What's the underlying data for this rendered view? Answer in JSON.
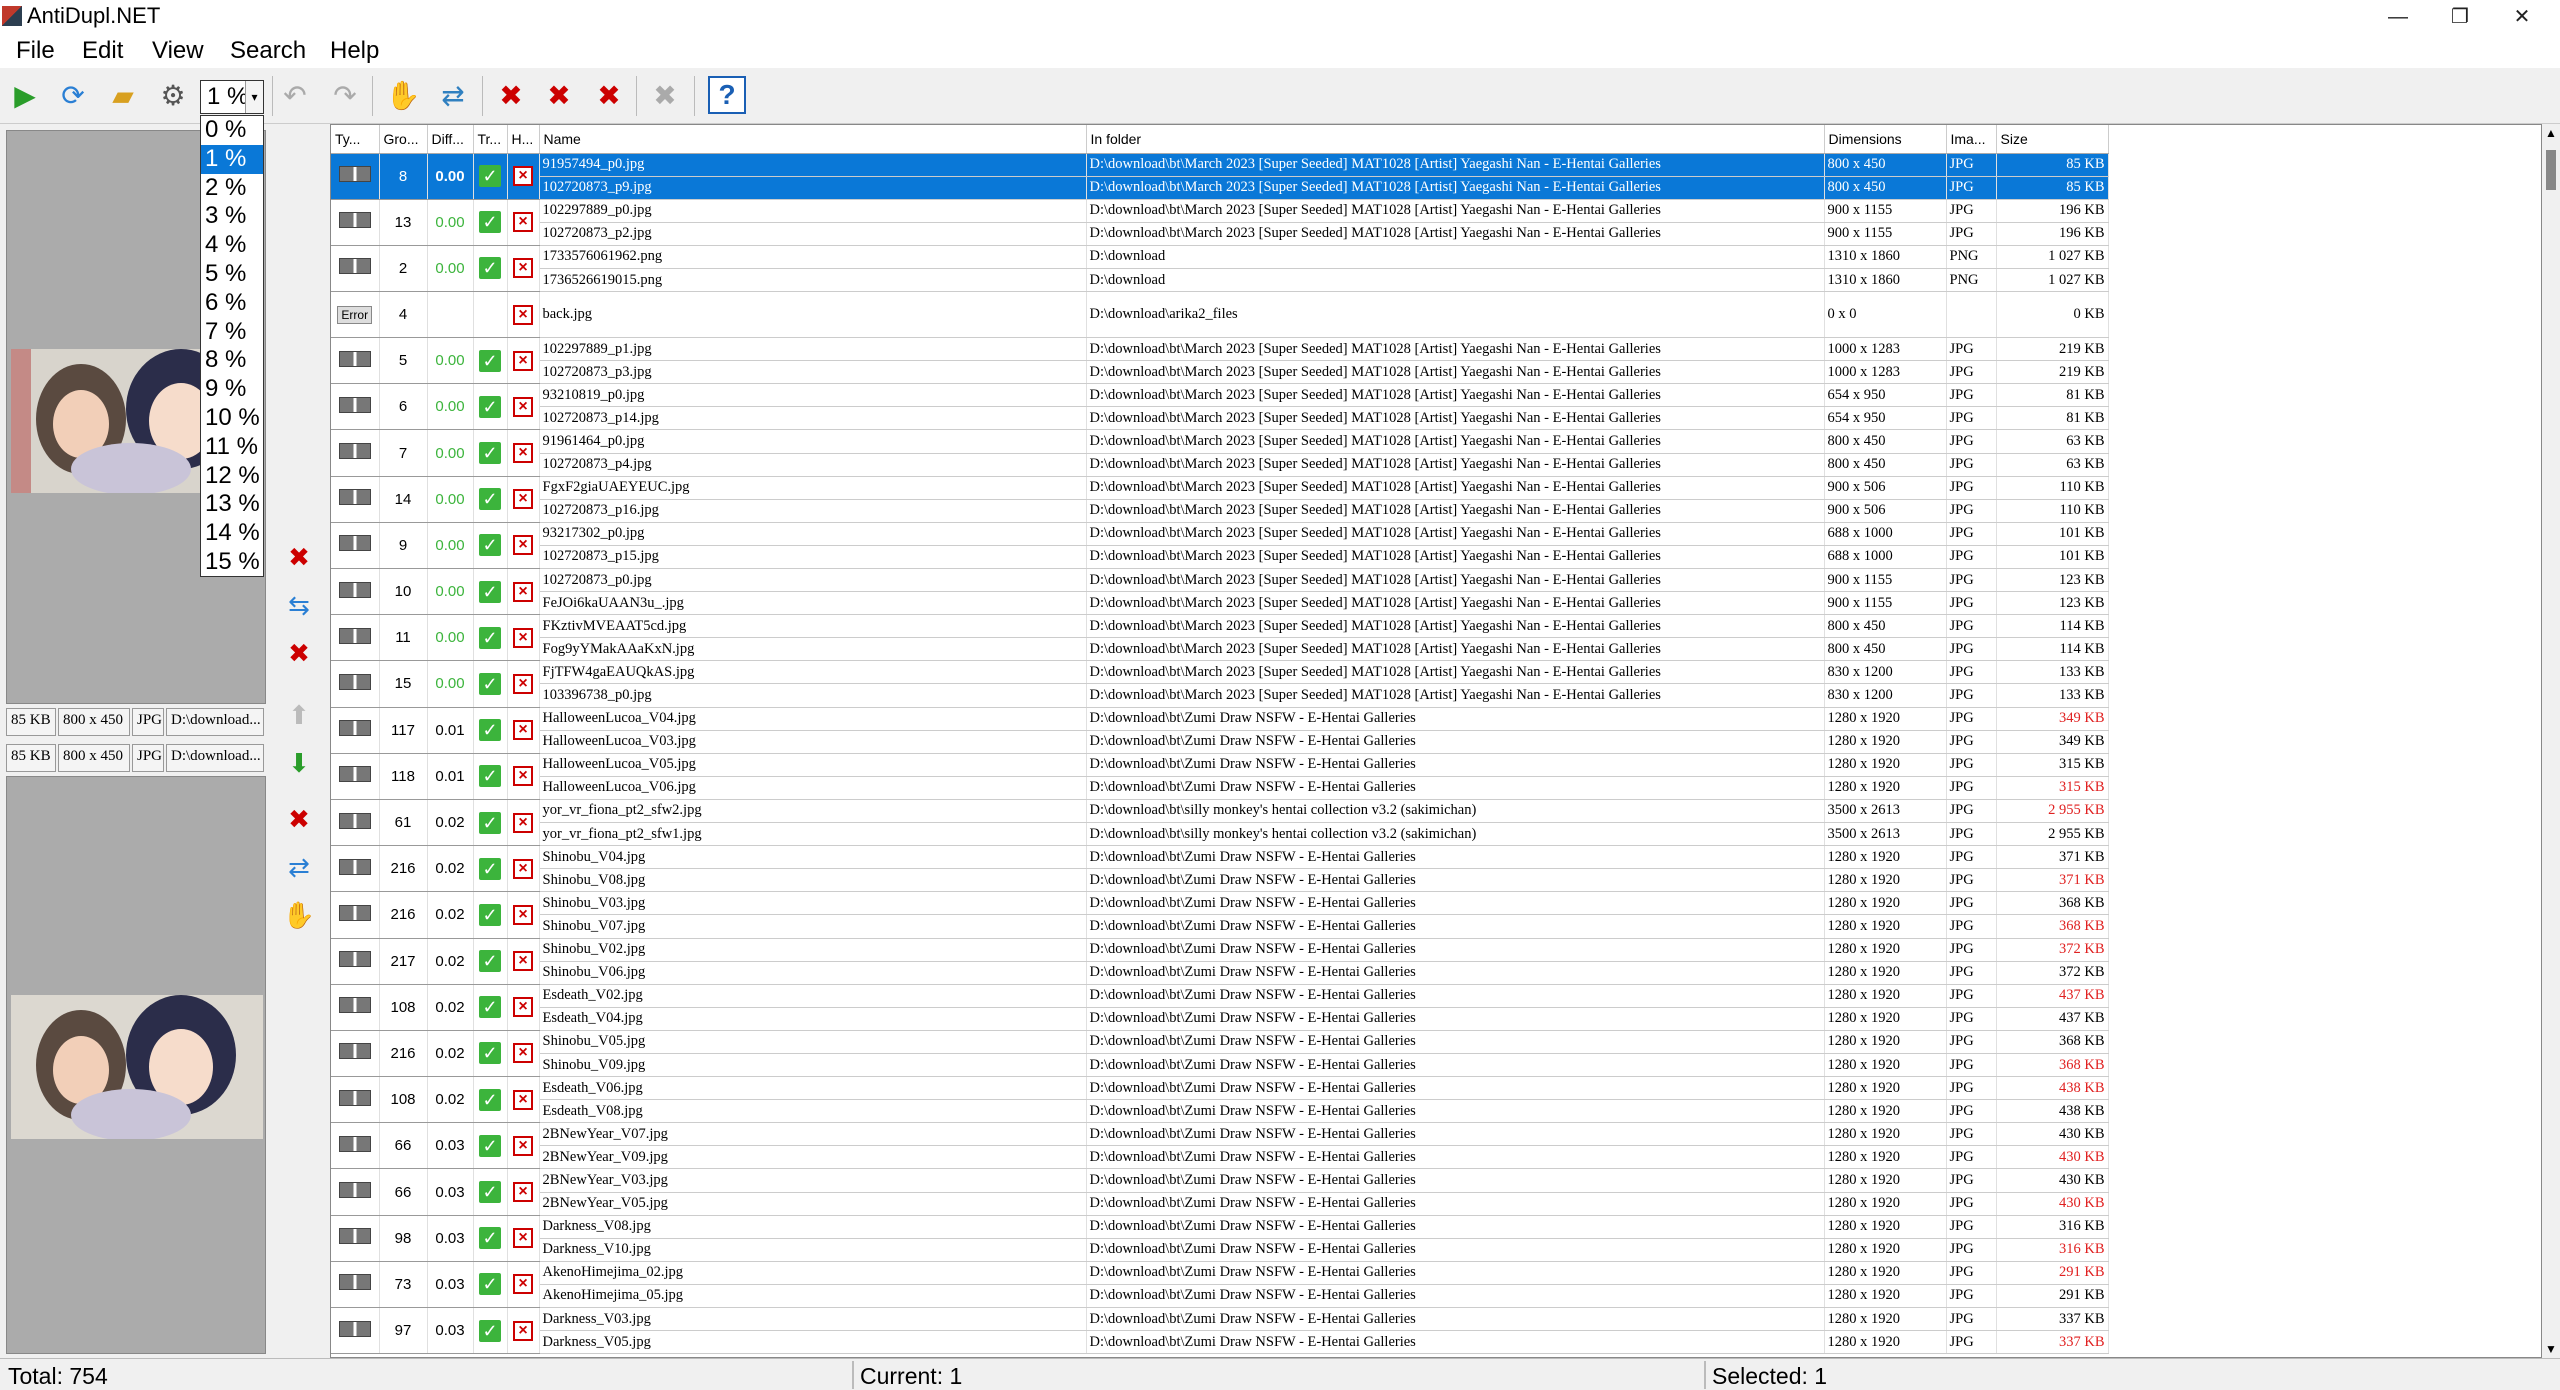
{
  "app": {
    "title": "AntiDupl.NET",
    "window_buttons": [
      "—",
      "❐",
      "✕"
    ]
  },
  "menu": [
    "File",
    "Edit",
    "View",
    "Search",
    "Help"
  ],
  "toolbar": {
    "threshold_value": "1 %",
    "threshold_options": [
      "0 %",
      "1 %",
      "2 %",
      "3 %",
      "4 %",
      "5 %",
      "6 %",
      "7 %",
      "8 %",
      "9 %",
      "10 %",
      "11 %",
      "12 %",
      "13 %",
      "14 %",
      "15 %"
    ],
    "threshold_selected_index": 1,
    "help_label": "?"
  },
  "preview": {
    "first": {
      "size": "85 KB",
      "dims": "800 x 450",
      "type": "JPG",
      "path": "D:\\download..."
    },
    "second": {
      "size": "85 KB",
      "dims": "800 x 450",
      "type": "JPG",
      "path": "D:\\download..."
    }
  },
  "columns": [
    "Ty...",
    "Gro...",
    "Diff...",
    "Tr...",
    "H...",
    "Name",
    "In folder",
    "Dimensions",
    "Ima...",
    "Size"
  ],
  "groups": [
    {
      "type": "img",
      "group": "8",
      "diff": "0.00",
      "status": "ok",
      "selected": true,
      "rows": [
        {
          "name": "91957494_p0.jpg",
          "folder": "D:\\download\\bt\\March 2023 [Super Seeded] MAT1028  [Artist] Yaegashi Nan - E-Hentai Galleries",
          "dims": "800 x 450",
          "fmt": "JPG",
          "size": "85 KB",
          "red": false
        },
        {
          "name": "102720873_p9.jpg",
          "folder": "D:\\download\\bt\\March 2023 [Super Seeded] MAT1028  [Artist] Yaegashi Nan - E-Hentai Galleries",
          "dims": "800 x 450",
          "fmt": "JPG",
          "size": "85 KB",
          "red": false
        }
      ]
    },
    {
      "type": "img",
      "group": "13",
      "diff": "0.00",
      "status": "ok",
      "rows": [
        {
          "name": "102297889_p0.jpg",
          "folder": "D:\\download\\bt\\March 2023 [Super Seeded] MAT1028  [Artist] Yaegashi Nan - E-Hentai Galleries",
          "dims": "900 x 1155",
          "fmt": "JPG",
          "size": "196 KB",
          "red": false
        },
        {
          "name": "102720873_p2.jpg",
          "folder": "D:\\download\\bt\\March 2023 [Super Seeded] MAT1028  [Artist] Yaegashi Nan - E-Hentai Galleries",
          "dims": "900 x 1155",
          "fmt": "JPG",
          "size": "196 KB",
          "red": false
        }
      ]
    },
    {
      "type": "img",
      "group": "2",
      "diff": "0.00",
      "status": "ok",
      "rows": [
        {
          "name": "1733576061962.png",
          "folder": "D:\\download",
          "dims": "1310 x 1860",
          "fmt": "PNG",
          "size": "1 027 KB",
          "red": false
        },
        {
          "name": "1736526619015.png",
          "folder": "D:\\download",
          "dims": "1310 x 1860",
          "fmt": "PNG",
          "size": "1 027 KB",
          "red": false
        }
      ]
    },
    {
      "type": "error",
      "group": "4",
      "diff": "",
      "status": "none",
      "rows": [
        {
          "name": "back.jpg",
          "folder": "D:\\download\\arika2_files",
          "dims": "0 x 0",
          "fmt": "",
          "size": "0 KB",
          "red": false
        }
      ]
    },
    {
      "type": "img",
      "group": "5",
      "diff": "0.00",
      "status": "ok",
      "rows": [
        {
          "name": "102297889_p1.jpg",
          "folder": "D:\\download\\bt\\March 2023 [Super Seeded] MAT1028  [Artist] Yaegashi Nan - E-Hentai Galleries",
          "dims": "1000 x 1283",
          "fmt": "JPG",
          "size": "219 KB",
          "red": false
        },
        {
          "name": "102720873_p3.jpg",
          "folder": "D:\\download\\bt\\March 2023 [Super Seeded] MAT1028  [Artist] Yaegashi Nan - E-Hentai Galleries",
          "dims": "1000 x 1283",
          "fmt": "JPG",
          "size": "219 KB",
          "red": false
        }
      ]
    },
    {
      "type": "img",
      "group": "6",
      "diff": "0.00",
      "status": "ok",
      "rows": [
        {
          "name": "93210819_p0.jpg",
          "folder": "D:\\download\\bt\\March 2023 [Super Seeded] MAT1028  [Artist] Yaegashi Nan - E-Hentai Galleries",
          "dims": "654 x 950",
          "fmt": "JPG",
          "size": "81 KB",
          "red": false
        },
        {
          "name": "102720873_p14.jpg",
          "folder": "D:\\download\\bt\\March 2023 [Super Seeded] MAT1028  [Artist] Yaegashi Nan - E-Hentai Galleries",
          "dims": "654 x 950",
          "fmt": "JPG",
          "size": "81 KB",
          "red": false
        }
      ]
    },
    {
      "type": "img",
      "group": "7",
      "diff": "0.00",
      "status": "ok",
      "rows": [
        {
          "name": "91961464_p0.jpg",
          "folder": "D:\\download\\bt\\March 2023 [Super Seeded] MAT1028  [Artist] Yaegashi Nan - E-Hentai Galleries",
          "dims": "800 x 450",
          "fmt": "JPG",
          "size": "63 KB",
          "red": false
        },
        {
          "name": "102720873_p4.jpg",
          "folder": "D:\\download\\bt\\March 2023 [Super Seeded] MAT1028  [Artist] Yaegashi Nan - E-Hentai Galleries",
          "dims": "800 x 450",
          "fmt": "JPG",
          "size": "63 KB",
          "red": false
        }
      ]
    },
    {
      "type": "img",
      "group": "14",
      "diff": "0.00",
      "status": "ok",
      "rows": [
        {
          "name": "FgxF2giaUAEYEUC.jpg",
          "folder": "D:\\download\\bt\\March 2023 [Super Seeded] MAT1028  [Artist] Yaegashi Nan - E-Hentai Galleries",
          "dims": "900 x 506",
          "fmt": "JPG",
          "size": "110 KB",
          "red": false
        },
        {
          "name": "102720873_p16.jpg",
          "folder": "D:\\download\\bt\\March 2023 [Super Seeded] MAT1028  [Artist] Yaegashi Nan - E-Hentai Galleries",
          "dims": "900 x 506",
          "fmt": "JPG",
          "size": "110 KB",
          "red": false
        }
      ]
    },
    {
      "type": "img",
      "group": "9",
      "diff": "0.00",
      "status": "ok",
      "rows": [
        {
          "name": "93217302_p0.jpg",
          "folder": "D:\\download\\bt\\March 2023 [Super Seeded] MAT1028  [Artist] Yaegashi Nan - E-Hentai Galleries",
          "dims": "688 x 1000",
          "fmt": "JPG",
          "size": "101 KB",
          "red": false
        },
        {
          "name": "102720873_p15.jpg",
          "folder": "D:\\download\\bt\\March 2023 [Super Seeded] MAT1028  [Artist] Yaegashi Nan - E-Hentai Galleries",
          "dims": "688 x 1000",
          "fmt": "JPG",
          "size": "101 KB",
          "red": false
        }
      ]
    },
    {
      "type": "img",
      "group": "10",
      "diff": "0.00",
      "status": "ok",
      "rows": [
        {
          "name": "102720873_p0.jpg",
          "folder": "D:\\download\\bt\\March 2023 [Super Seeded] MAT1028  [Artist] Yaegashi Nan - E-Hentai Galleries",
          "dims": "900 x 1155",
          "fmt": "JPG",
          "size": "123 KB",
          "red": false
        },
        {
          "name": "FeJOi6kaUAAN3u_.jpg",
          "folder": "D:\\download\\bt\\March 2023 [Super Seeded] MAT1028  [Artist] Yaegashi Nan - E-Hentai Galleries",
          "dims": "900 x 1155",
          "fmt": "JPG",
          "size": "123 KB",
          "red": false
        }
      ]
    },
    {
      "type": "img",
      "group": "11",
      "diff": "0.00",
      "status": "ok",
      "rows": [
        {
          "name": "FKztivMVEAAT5cd.jpg",
          "folder": "D:\\download\\bt\\March 2023 [Super Seeded] MAT1028  [Artist] Yaegashi Nan - E-Hentai Galleries",
          "dims": "800 x 450",
          "fmt": "JPG",
          "size": "114 KB",
          "red": false
        },
        {
          "name": "Fog9yYMakAAaKxN.jpg",
          "folder": "D:\\download\\bt\\March 2023 [Super Seeded] MAT1028  [Artist] Yaegashi Nan - E-Hentai Galleries",
          "dims": "800 x 450",
          "fmt": "JPG",
          "size": "114 KB",
          "red": false
        }
      ]
    },
    {
      "type": "img",
      "group": "15",
      "diff": "0.00",
      "status": "ok",
      "rows": [
        {
          "name": "FjTFW4gaEAUQkAS.jpg",
          "folder": "D:\\download\\bt\\March 2023 [Super Seeded] MAT1028  [Artist] Yaegashi Nan - E-Hentai Galleries",
          "dims": "830 x 1200",
          "fmt": "JPG",
          "size": "133 KB",
          "red": false
        },
        {
          "name": "103396738_p0.jpg",
          "folder": "D:\\download\\bt\\March 2023 [Super Seeded] MAT1028  [Artist] Yaegashi Nan - E-Hentai Galleries",
          "dims": "830 x 1200",
          "fmt": "JPG",
          "size": "133 KB",
          "red": false
        }
      ]
    },
    {
      "type": "img",
      "group": "117",
      "diff": "0.01",
      "status": "ok",
      "rows": [
        {
          "name": "HalloweenLucoa_V04.jpg",
          "folder": "D:\\download\\bt\\Zumi Draw NSFW - E-Hentai Galleries",
          "dims": "1280 x 1920",
          "fmt": "JPG",
          "size": "349 KB",
          "red": true
        },
        {
          "name": "HalloweenLucoa_V03.jpg",
          "folder": "D:\\download\\bt\\Zumi Draw NSFW - E-Hentai Galleries",
          "dims": "1280 x 1920",
          "fmt": "JPG",
          "size": "349 KB",
          "red": false
        }
      ]
    },
    {
      "type": "img",
      "group": "118",
      "diff": "0.01",
      "status": "ok",
      "rows": [
        {
          "name": "HalloweenLucoa_V05.jpg",
          "folder": "D:\\download\\bt\\Zumi Draw NSFW - E-Hentai Galleries",
          "dims": "1280 x 1920",
          "fmt": "JPG",
          "size": "315 KB",
          "red": false
        },
        {
          "name": "HalloweenLucoa_V06.jpg",
          "folder": "D:\\download\\bt\\Zumi Draw NSFW - E-Hentai Galleries",
          "dims": "1280 x 1920",
          "fmt": "JPG",
          "size": "315 KB",
          "red": true
        }
      ]
    },
    {
      "type": "img",
      "group": "61",
      "diff": "0.02",
      "status": "ok",
      "rows": [
        {
          "name": "yor_vr_fiona_pt2_sfw2.jpg",
          "folder": "D:\\download\\bt\\silly monkey's hentai collection v3.2 (sakimichan)",
          "dims": "3500 x 2613",
          "fmt": "JPG",
          "size": "2 955 KB",
          "red": true
        },
        {
          "name": "yor_vr_fiona_pt2_sfw1.jpg",
          "folder": "D:\\download\\bt\\silly monkey's hentai collection v3.2 (sakimichan)",
          "dims": "3500 x 2613",
          "fmt": "JPG",
          "size": "2 955 KB",
          "red": false
        }
      ]
    },
    {
      "type": "img",
      "group": "216",
      "diff": "0.02",
      "status": "ok",
      "rows": [
        {
          "name": "Shinobu_V04.jpg",
          "folder": "D:\\download\\bt\\Zumi Draw NSFW - E-Hentai Galleries",
          "dims": "1280 x 1920",
          "fmt": "JPG",
          "size": "371 KB",
          "red": false
        },
        {
          "name": "Shinobu_V08.jpg",
          "folder": "D:\\download\\bt\\Zumi Draw NSFW - E-Hentai Galleries",
          "dims": "1280 x 1920",
          "fmt": "JPG",
          "size": "371 KB",
          "red": true
        }
      ]
    },
    {
      "type": "img",
      "group": "216",
      "diff": "0.02",
      "status": "ok",
      "rows": [
        {
          "name": "Shinobu_V03.jpg",
          "folder": "D:\\download\\bt\\Zumi Draw NSFW - E-Hentai Galleries",
          "dims": "1280 x 1920",
          "fmt": "JPG",
          "size": "368 KB",
          "red": false
        },
        {
          "name": "Shinobu_V07.jpg",
          "folder": "D:\\download\\bt\\Zumi Draw NSFW - E-Hentai Galleries",
          "dims": "1280 x 1920",
          "fmt": "JPG",
          "size": "368 KB",
          "red": true
        }
      ]
    },
    {
      "type": "img",
      "group": "217",
      "diff": "0.02",
      "status": "ok",
      "rows": [
        {
          "name": "Shinobu_V02.jpg",
          "folder": "D:\\download\\bt\\Zumi Draw NSFW - E-Hentai Galleries",
          "dims": "1280 x 1920",
          "fmt": "JPG",
          "size": "372 KB",
          "red": true
        },
        {
          "name": "Shinobu_V06.jpg",
          "folder": "D:\\download\\bt\\Zumi Draw NSFW - E-Hentai Galleries",
          "dims": "1280 x 1920",
          "fmt": "JPG",
          "size": "372 KB",
          "red": false
        }
      ]
    },
    {
      "type": "img",
      "group": "108",
      "diff": "0.02",
      "status": "ok",
      "rows": [
        {
          "name": "Esdeath_V02.jpg",
          "folder": "D:\\download\\bt\\Zumi Draw NSFW - E-Hentai Galleries",
          "dims": "1280 x 1920",
          "fmt": "JPG",
          "size": "437 KB",
          "red": true
        },
        {
          "name": "Esdeath_V04.jpg",
          "folder": "D:\\download\\bt\\Zumi Draw NSFW - E-Hentai Galleries",
          "dims": "1280 x 1920",
          "fmt": "JPG",
          "size": "437 KB",
          "red": false
        }
      ]
    },
    {
      "type": "img",
      "group": "216",
      "diff": "0.02",
      "status": "ok",
      "rows": [
        {
          "name": "Shinobu_V05.jpg",
          "folder": "D:\\download\\bt\\Zumi Draw NSFW - E-Hentai Galleries",
          "dims": "1280 x 1920",
          "fmt": "JPG",
          "size": "368 KB",
          "red": false
        },
        {
          "name": "Shinobu_V09.jpg",
          "folder": "D:\\download\\bt\\Zumi Draw NSFW - E-Hentai Galleries",
          "dims": "1280 x 1920",
          "fmt": "JPG",
          "size": "368 KB",
          "red": true
        }
      ]
    },
    {
      "type": "img",
      "group": "108",
      "diff": "0.02",
      "status": "ok",
      "rows": [
        {
          "name": "Esdeath_V06.jpg",
          "folder": "D:\\download\\bt\\Zumi Draw NSFW - E-Hentai Galleries",
          "dims": "1280 x 1920",
          "fmt": "JPG",
          "size": "438 KB",
          "red": true
        },
        {
          "name": "Esdeath_V08.jpg",
          "folder": "D:\\download\\bt\\Zumi Draw NSFW - E-Hentai Galleries",
          "dims": "1280 x 1920",
          "fmt": "JPG",
          "size": "438 KB",
          "red": false
        }
      ]
    },
    {
      "type": "img",
      "group": "66",
      "diff": "0.03",
      "status": "ok",
      "rows": [
        {
          "name": "2BNewYear_V07.jpg",
          "folder": "D:\\download\\bt\\Zumi Draw NSFW - E-Hentai Galleries",
          "dims": "1280 x 1920",
          "fmt": "JPG",
          "size": "430 KB",
          "red": false
        },
        {
          "name": "2BNewYear_V09.jpg",
          "folder": "D:\\download\\bt\\Zumi Draw NSFW - E-Hentai Galleries",
          "dims": "1280 x 1920",
          "fmt": "JPG",
          "size": "430 KB",
          "red": true
        }
      ]
    },
    {
      "type": "img",
      "group": "66",
      "diff": "0.03",
      "status": "ok",
      "rows": [
        {
          "name": "2BNewYear_V03.jpg",
          "folder": "D:\\download\\bt\\Zumi Draw NSFW - E-Hentai Galleries",
          "dims": "1280 x 1920",
          "fmt": "JPG",
          "size": "430 KB",
          "red": false
        },
        {
          "name": "2BNewYear_V05.jpg",
          "folder": "D:\\download\\bt\\Zumi Draw NSFW - E-Hentai Galleries",
          "dims": "1280 x 1920",
          "fmt": "JPG",
          "size": "430 KB",
          "red": true
        }
      ]
    },
    {
      "type": "img",
      "group": "98",
      "diff": "0.03",
      "status": "ok",
      "rows": [
        {
          "name": "Darkness_V08.jpg",
          "folder": "D:\\download\\bt\\Zumi Draw NSFW - E-Hentai Galleries",
          "dims": "1280 x 1920",
          "fmt": "JPG",
          "size": "316 KB",
          "red": false
        },
        {
          "name": "Darkness_V10.jpg",
          "folder": "D:\\download\\bt\\Zumi Draw NSFW - E-Hentai Galleries",
          "dims": "1280 x 1920",
          "fmt": "JPG",
          "size": "316 KB",
          "red": true
        }
      ]
    },
    {
      "type": "img",
      "group": "73",
      "diff": "0.03",
      "status": "bad",
      "rows": [
        {
          "name": "AkenoHimejima_02.jpg",
          "folder": "D:\\download\\bt\\Zumi Draw NSFW - E-Hentai Galleries",
          "dims": "1280 x 1920",
          "fmt": "JPG",
          "size": "291 KB",
          "red": true
        },
        {
          "name": "AkenoHimejima_05.jpg",
          "folder": "D:\\download\\bt\\Zumi Draw NSFW - E-Hentai Galleries",
          "dims": "1280 x 1920",
          "fmt": "JPG",
          "size": "291 KB",
          "red": false
        }
      ]
    },
    {
      "type": "img",
      "group": "97",
      "diff": "0.03",
      "status": "ok",
      "rows": [
        {
          "name": "Darkness_V03.jpg",
          "folder": "D:\\download\\bt\\Zumi Draw NSFW - E-Hentai Galleries",
          "dims": "1280 x 1920",
          "fmt": "JPG",
          "size": "337 KB",
          "red": false
        },
        {
          "name": "Darkness_V05.jpg",
          "folder": "D:\\download\\bt\\Zumi Draw NSFW - E-Hentai Galleries",
          "dims": "1280 x 1920",
          "fmt": "JPG",
          "size": "337 KB",
          "red": true
        }
      ]
    }
  ],
  "status": {
    "total": "Total: 754",
    "current": "Current: 1",
    "selected": "Selected: 1"
  }
}
